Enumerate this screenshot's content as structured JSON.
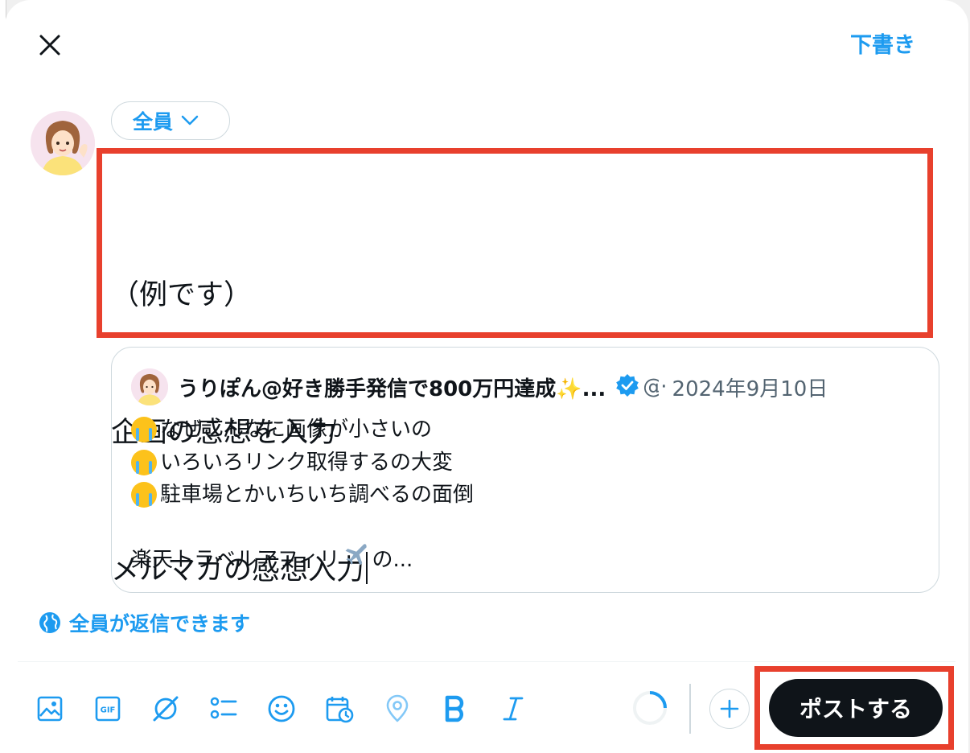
{
  "header": {
    "drafts_label": "下書き"
  },
  "compose": {
    "audience_label": "全員",
    "lines": [
      "（例です）",
      "企画の感想を入力",
      "メルマガの感想入力"
    ]
  },
  "quoted_post": {
    "author_name": "うりぽん@好き勝手発信で800万円達成✨...",
    "handle": "@",
    "separator": "·",
    "date": "2024年9月10日",
    "body_lines": [
      "なぜこんなに画像が小さいの",
      "いろいろリンク取得するの大変",
      "駐車場とかいちいち調べるの面倒",
      "",
      "楽天トラベルアフィリ"
    ],
    "last_line_suffix": "の..."
  },
  "reply_setting": {
    "label": "全員が返信できます"
  },
  "toolbar": {
    "icons": [
      "media-icon",
      "gif-icon",
      "grok-icon",
      "poll-icon",
      "emoji-icon",
      "schedule-icon",
      "location-icon",
      "bold-icon",
      "italic-icon"
    ],
    "post_label": "ポストする"
  },
  "colors": {
    "accent": "#1d9bf0",
    "highlight": "#e8402d",
    "post_button": "#0f1419"
  }
}
